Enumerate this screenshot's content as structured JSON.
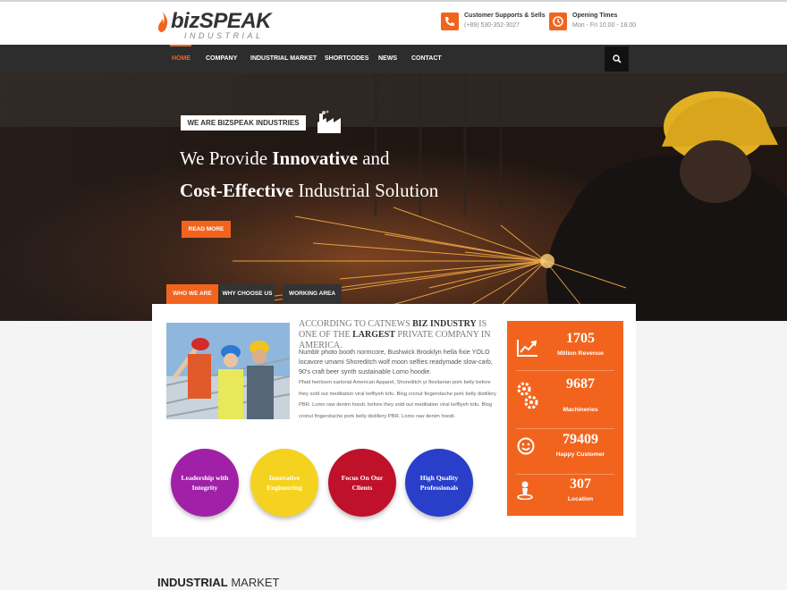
{
  "logo": {
    "brand": "bizSPEAK",
    "sub": "INDUSTRIAL"
  },
  "contacts": [
    {
      "title": "Customer Supports & Sells",
      "detail": "(+89) 530-352-3027",
      "icon": "phone-icon"
    },
    {
      "title": "Opening Times",
      "detail": "Mon - Fri 10.00 - 18.00",
      "icon": "clock-icon"
    }
  ],
  "nav": {
    "items": [
      "HOME",
      "COMPANY",
      "INDUSTRIAL MARKET",
      "SHORTCODES",
      "NEWS",
      "CONTACT"
    ],
    "active": "HOME"
  },
  "hero": {
    "tag": "WE ARE BIZSPEAK INDUSTRIES",
    "line1_pre": "We Provide ",
    "line1_bold": "Innovative",
    "line1_post": " and",
    "line2_bold": "Cost-Effective",
    "line2_post": " Industrial Solution",
    "button": "READ MORE"
  },
  "tabs": [
    "WHO WE ARE",
    "WHY CHOOSE US",
    "WORKING AREA"
  ],
  "intro": {
    "t1": "ACCORDING TO CATNEWS ",
    "b1": "BIZ INDUSTRY",
    "t2": " IS ONE OF THE ",
    "b2": "LARGEST",
    "t3": " PRIVATE COMPANY IN AMERICA."
  },
  "para1": "Numblr photo booth normcore, Bushwick Brooklyn hella fixie YOLO locavore umami Shoreditch wolf moon selfies readymade slow-carb, 90's craft beer synth sustainable Lomo hoodie.",
  "para2": "Pfaid heirloom sartorial American Apparel, Shoreditch yr flexitarian pork belly before they sold out meditation viral keffiyeh tofu. Blog cronut fingerstache pork belly distillery PBR. Lomo raw denim hoodi. before they sold out meditation viral keffiyeh tofu. Blog cronut fingerstache pork belly distillery PBR. Lomo raw denim hoodi.",
  "circles": [
    {
      "label": "Leadership with Integrity",
      "color": "#a020a8"
    },
    {
      "label": "Innovative Engineering",
      "color": "#f5d21f"
    },
    {
      "label": "Focus On Our Clients",
      "color": "#c0112b"
    },
    {
      "label": "High Quality Professionals",
      "color": "#2a3fc9"
    }
  ],
  "stats": [
    {
      "value": "1705",
      "label": "Million Revenue",
      "icon": "chart-trend-icon"
    },
    {
      "value": "9687",
      "label": "Machineries",
      "icon": "gears-icon"
    },
    {
      "value": "79409",
      "label": "Happy Customer",
      "icon": "smile-icon"
    },
    {
      "value": "307",
      "label": "Location",
      "icon": "location-pin-icon"
    }
  ],
  "section": {
    "bold": "INDUSTRIAL",
    "rest": " MARKET"
  },
  "colors": {
    "accent": "#f2641e",
    "nav": "#2d2d2d"
  }
}
